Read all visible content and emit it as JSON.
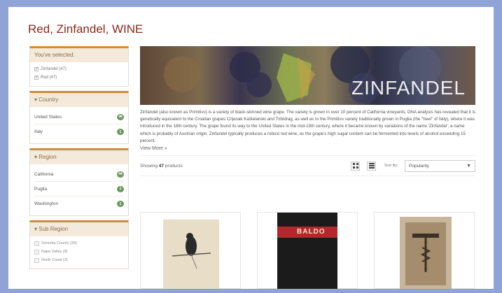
{
  "page": {
    "title": "Red, Zinfandel, WINE"
  },
  "sidebar": {
    "selected": {
      "heading": "You've selected:",
      "items": [
        {
          "label": "Zinfandel (47)"
        },
        {
          "label": "Red (47)"
        }
      ]
    },
    "country": {
      "heading": "Country",
      "items": [
        {
          "label": "United States",
          "count": "46"
        },
        {
          "label": "Italy",
          "count": "1"
        }
      ]
    },
    "region": {
      "heading": "Region",
      "items": [
        {
          "label": "California",
          "count": "44"
        },
        {
          "label": "Puglia",
          "count": "1"
        },
        {
          "label": "Washington",
          "count": "1"
        }
      ]
    },
    "sub_region": {
      "heading": "Sub Region",
      "items": [
        {
          "label": "Sonoma County (20)"
        },
        {
          "label": "Napa Valley (9)"
        },
        {
          "label": "North Coast (3)"
        }
      ]
    }
  },
  "hero": {
    "text": "ZINFANDEL"
  },
  "description": {
    "text": "Zinfandel (also known as Primitivo) is a variety of black-skinned wine grape. The variety is grown in over 10 percent of California vineyards. DNA analysis has revealed that it is genetically equivalent to the Croatian grapes Crljenak Kaštelanski and Tribidrag, as well as to the Primitivo variety traditionally grown in Puglia (the \"heel\" of Italy), where it was introduced in the 18th century. The grape found its way to the United States in the mid-19th century, where it became known by variations of the name 'Zinfandel', a name which is probably of Austrian origin. Zinfandel typically produces a robust red wine, as the grape's high sugar content can be fermented into levels of alcohol exceeding 15 percent.",
    "view_more": "View More »"
  },
  "toolbar": {
    "showing_prefix": "Showing ",
    "showing_count": "47",
    "showing_suffix": " products",
    "sort_label": "Sort By:",
    "sort_value": "Popularity"
  },
  "products": [
    {
      "label_text": ""
    },
    {
      "label_text": "BALDO"
    },
    {
      "label_text": ""
    }
  ]
}
